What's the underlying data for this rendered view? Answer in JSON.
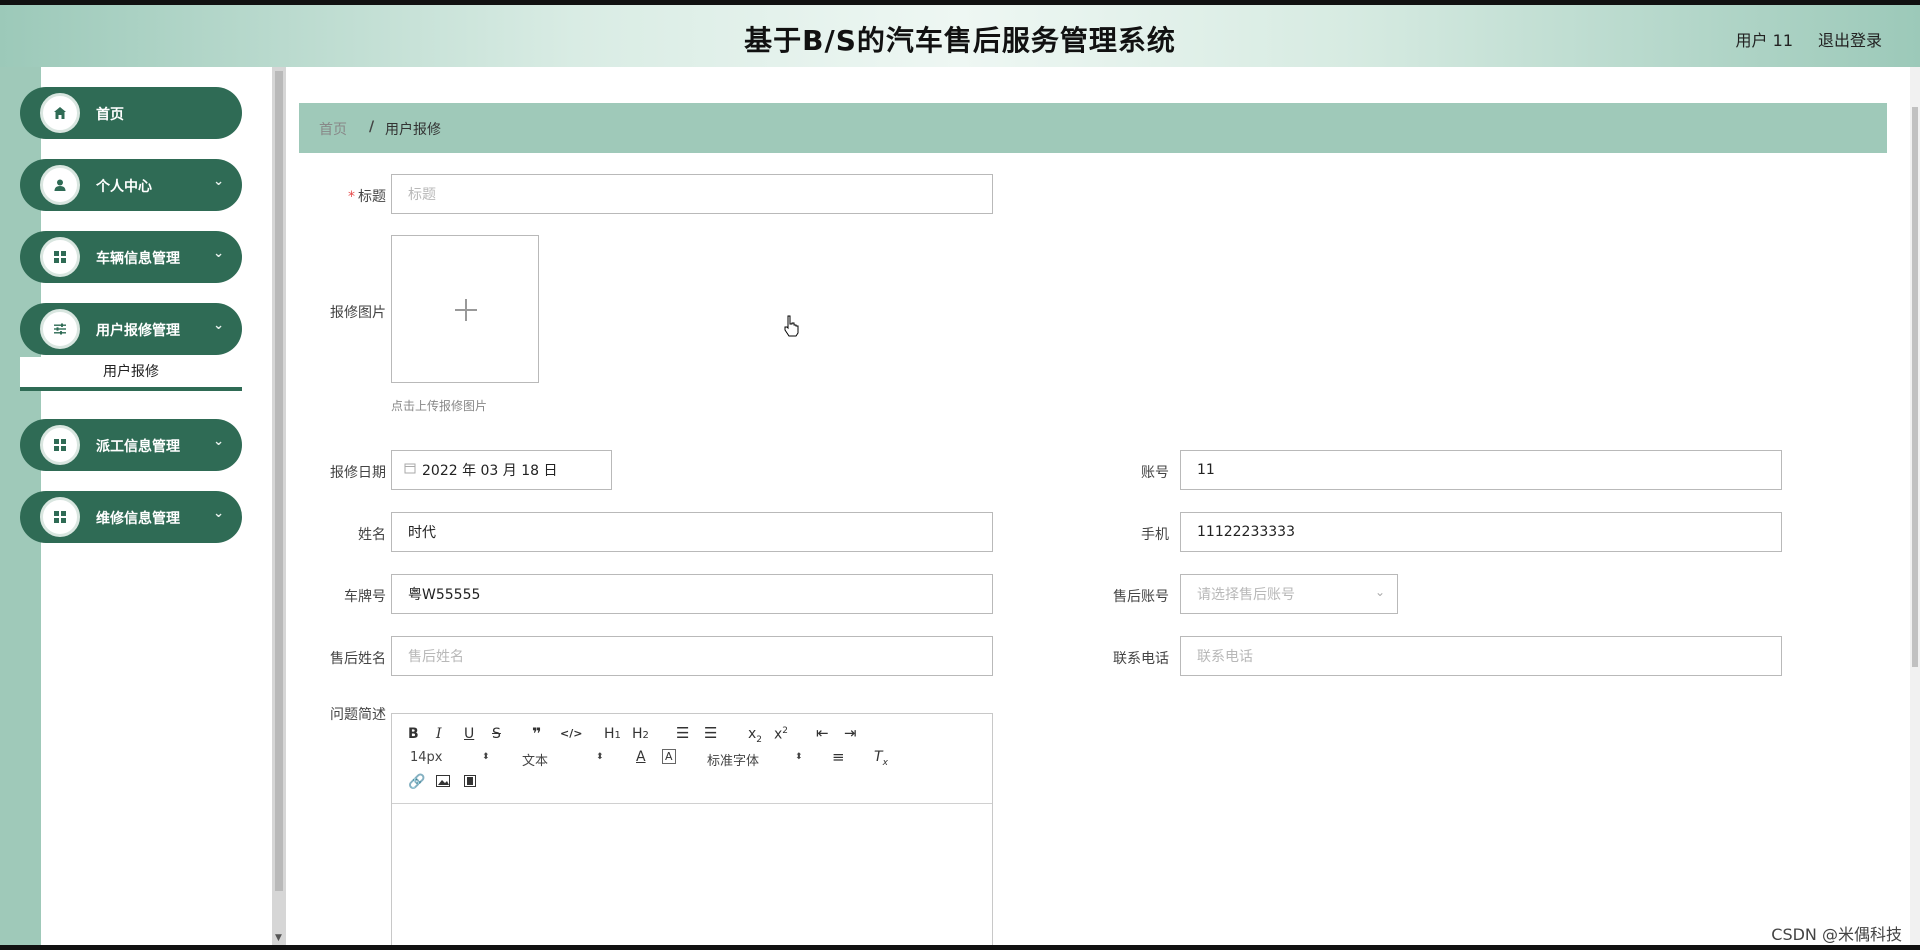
{
  "header": {
    "title": "基于B/S的汽车售后服务管理系统",
    "user": "用户 11",
    "logout": "退出登录"
  },
  "sidebar": {
    "items": [
      {
        "label": "首页",
        "icon": "home-icon"
      },
      {
        "label": "个人中心",
        "icon": "person-icon"
      },
      {
        "label": "车辆信息管理",
        "icon": "grid-icon"
      },
      {
        "label": "用户报修管理",
        "icon": "sliders-icon"
      },
      {
        "label": "派工信息管理",
        "icon": "grid-icon"
      },
      {
        "label": "维修信息管理",
        "icon": "grid-icon"
      }
    ],
    "submenu_active": "用户报修"
  },
  "breadcrumb": {
    "home": "首页",
    "separator": "/",
    "current": "用户报修"
  },
  "form": {
    "title": {
      "label": "标题",
      "placeholder": "标题"
    },
    "image": {
      "label": "报修图片",
      "hint": "点击上传报修图片"
    },
    "date": {
      "label": "报修日期",
      "value": "2022 年 03 月 18 日"
    },
    "account": {
      "label": "账号",
      "value": "11"
    },
    "name": {
      "label": "姓名",
      "value": "时代"
    },
    "phone": {
      "label": "手机",
      "value": "11122233333"
    },
    "plate": {
      "label": "车牌号",
      "value": "粤W55555"
    },
    "service_account": {
      "label": "售后账号",
      "placeholder": "请选择售后账号"
    },
    "service_name": {
      "label": "售后姓名",
      "placeholder": "售后姓名"
    },
    "contact": {
      "label": "联系电话",
      "placeholder": "联系电话"
    },
    "description": {
      "label": "问题简述"
    }
  },
  "editor": {
    "font_size": "14px",
    "text_style": "文本",
    "font_family": "标准字体"
  },
  "watermark": "CSDN @米偶科技",
  "colors": {
    "primary": "#2f6b55",
    "accent": "#9fc9b9"
  }
}
